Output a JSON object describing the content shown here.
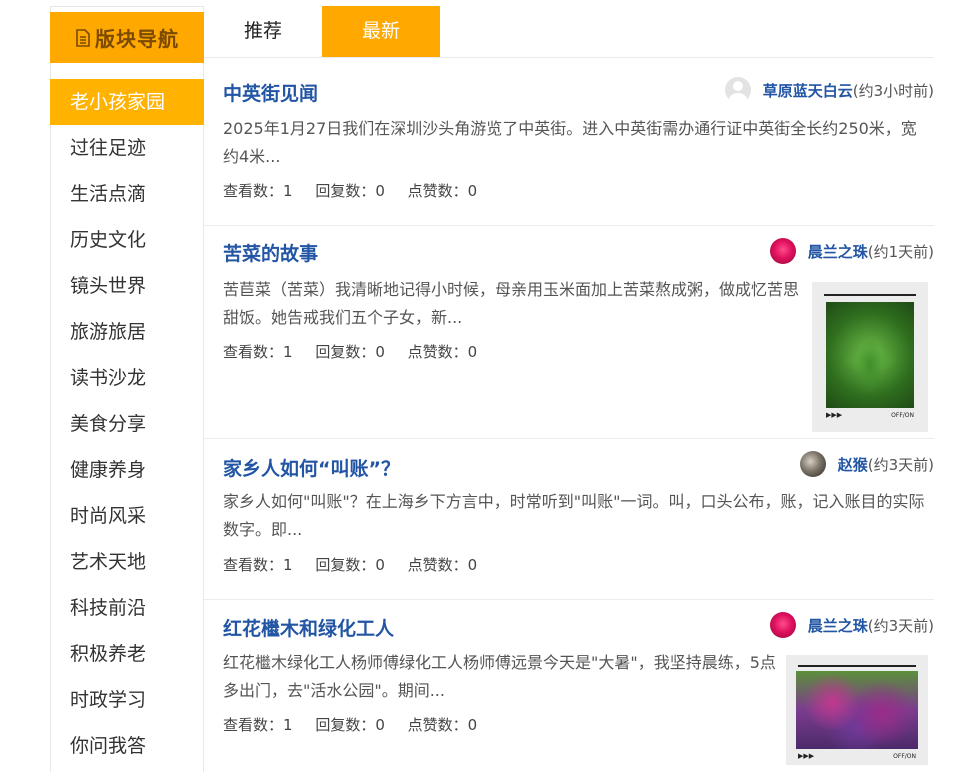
{
  "sidebar": {
    "header": "版块导航",
    "items": [
      {
        "label": "老小孩家园",
        "active": true
      },
      {
        "label": "过往足迹"
      },
      {
        "label": "生活点滴"
      },
      {
        "label": "历史文化"
      },
      {
        "label": "镜头世界"
      },
      {
        "label": "旅游旅居"
      },
      {
        "label": "读书沙龙"
      },
      {
        "label": "美食分享"
      },
      {
        "label": "健康养身"
      },
      {
        "label": "时尚风采"
      },
      {
        "label": "艺术天地"
      },
      {
        "label": "科技前沿"
      },
      {
        "label": "积极养老"
      },
      {
        "label": "时政学习"
      },
      {
        "label": "你问我答"
      }
    ]
  },
  "tabs": {
    "recommend": "推荐",
    "latest": "最新",
    "active": "latest"
  },
  "posts": [
    {
      "title": "中英街见闻",
      "author": "草原蓝天白云",
      "time": "(约3小时前)",
      "avatar": "default-avatar",
      "excerpt": "2025年1月27日我们在深圳沙头角游览了中英街。进入中英街需办通行证中英街全长约250米，宽约4米...",
      "views": "查看数：1",
      "replies": "回复数：0",
      "likes": "点赞数：0"
    },
    {
      "title": "苦菜的故事",
      "author": "晨兰之珠",
      "time": "(约1天前)",
      "avatar": "rose-avatar",
      "excerpt": "苦苣菜（苦菜）我清晰地记得小时候，母亲用玉米面加上苦菜熬成粥，做成忆苦思甜饭。她告戒我们五个子女，新...",
      "views": "查看数：1",
      "replies": "回复数：0",
      "likes": "点赞数：0",
      "thumb_caption": "OFF/ON"
    },
    {
      "title": "家乡人如何“叫账”？",
      "author": "赵猴",
      "time": "(约3天前)",
      "avatar": "photo-avatar",
      "excerpt": "家乡人如何\"叫账\"？在上海乡下方言中，时常听到\"叫账\"一词。叫，口头公布，账，记入账目的实际数字。即...",
      "views": "查看数：1",
      "replies": "回复数：0",
      "likes": "点赞数：0"
    },
    {
      "title": "红花檵木和绿化工人",
      "author": "晨兰之珠",
      "time": "(约3天前)",
      "avatar": "rose-avatar",
      "excerpt": "红花檵木绿化工人杨师傅绿化工人杨师傅远景今天是\"大暑\"，我坚持晨练，5点多出门，去\"活水公园\"。期间...",
      "views": "查看数：1",
      "replies": "回复数：0",
      "likes": "点赞数：0",
      "thumb_caption": "OFF/ON"
    }
  ],
  "colors": {
    "accent": "#ffa800",
    "link": "#2255a4"
  }
}
